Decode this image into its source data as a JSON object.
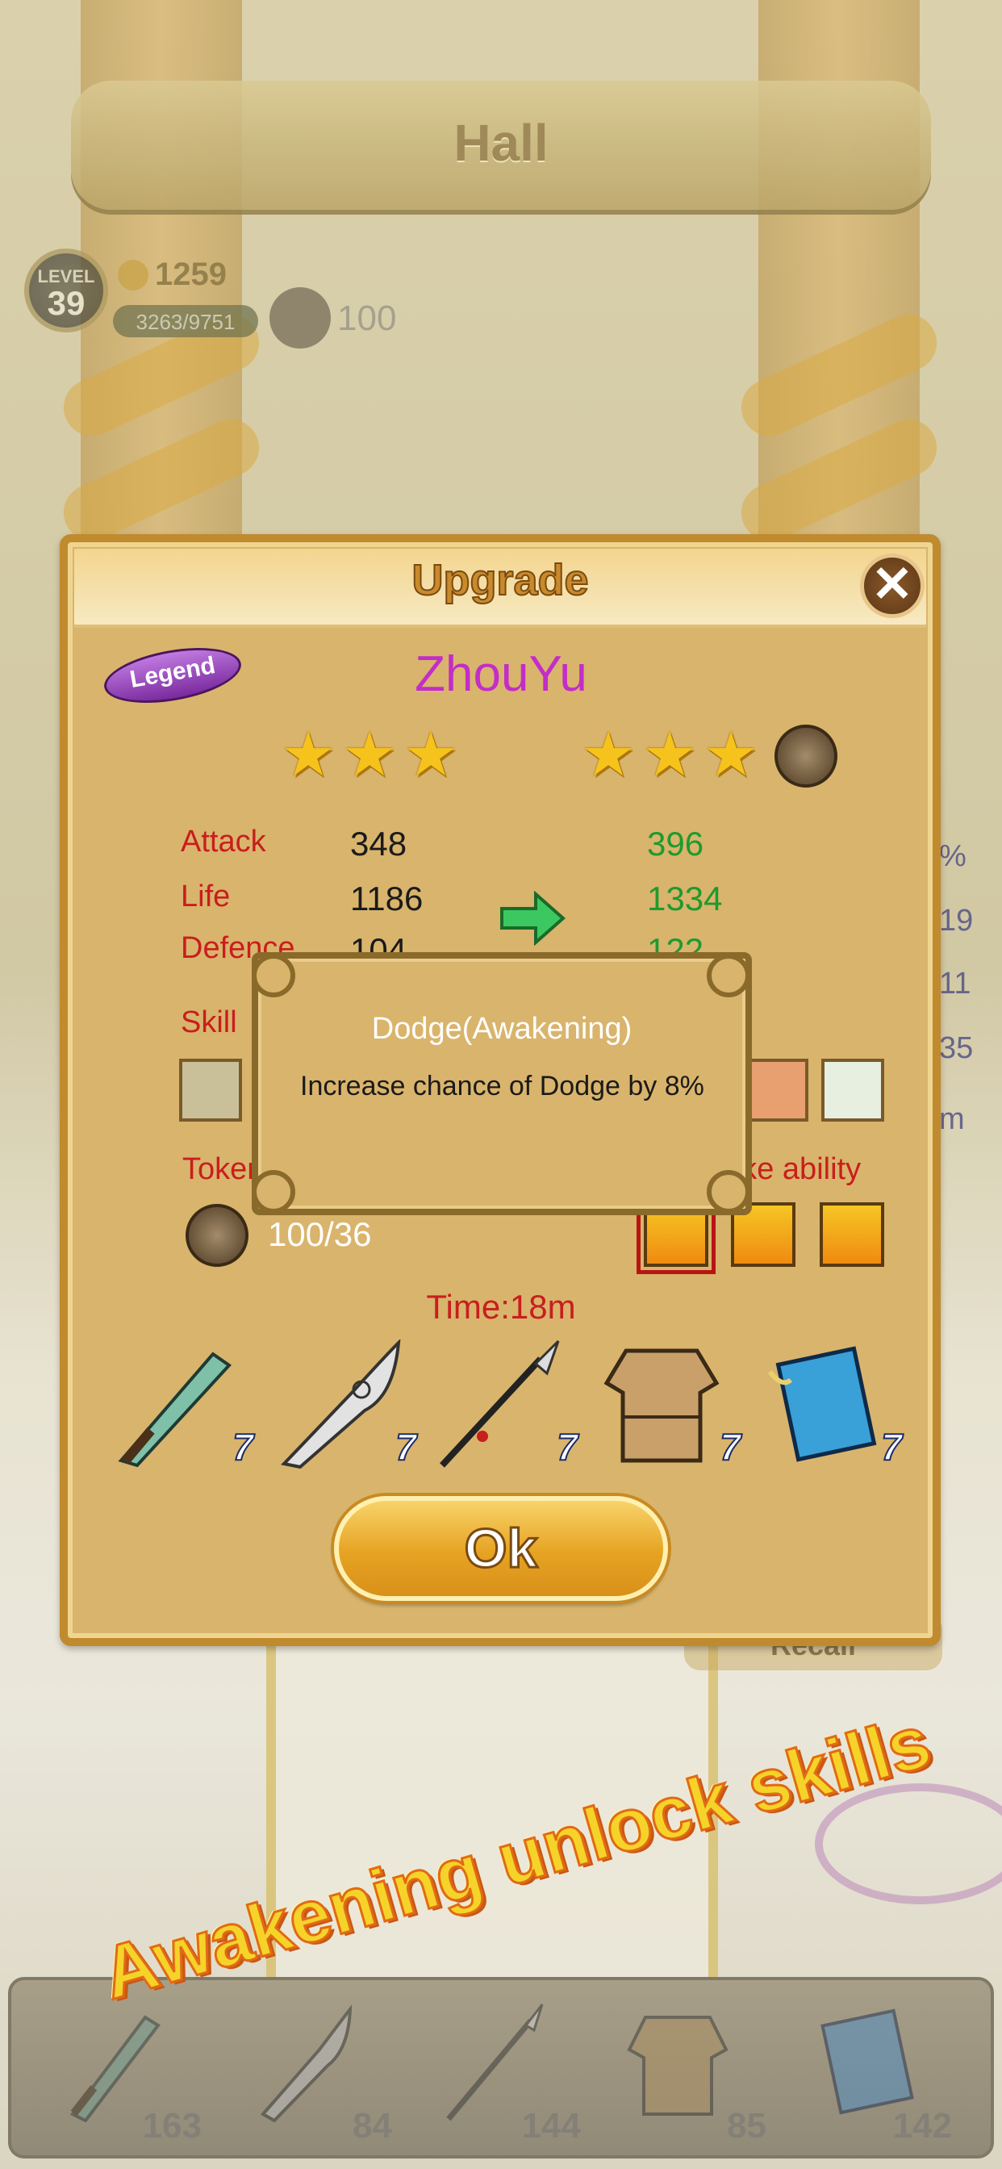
{
  "hall": {
    "title": "Hall"
  },
  "player": {
    "level_label": "LEVEL",
    "level": "39",
    "gold": "1259",
    "exp": "3263/9751",
    "tokens": "100"
  },
  "background": {
    "side_values": [
      "%",
      "19",
      "11",
      "35",
      "m"
    ],
    "recall_label": "Recall"
  },
  "promo": {
    "text": "Awakening unlock skills"
  },
  "inventory": {
    "items": [
      {
        "icon": "sword-icon",
        "count": "163"
      },
      {
        "icon": "blade-icon",
        "count": "84"
      },
      {
        "icon": "spear-icon",
        "count": "144"
      },
      {
        "icon": "armor-icon",
        "count": "85"
      },
      {
        "icon": "book-icon",
        "count": "142"
      }
    ]
  },
  "dialog": {
    "title": "Upgrade",
    "rarity": "Legend",
    "hero_name": "ZhouYu",
    "current_stars": 3,
    "next_stars": 3,
    "stats": [
      {
        "label": "Attack",
        "value": "348",
        "next": "396"
      },
      {
        "label": "Life",
        "value": "1186",
        "next": "1334"
      },
      {
        "label": "Defence",
        "value": "104",
        "next": "122"
      }
    ],
    "skill_label": "Skill",
    "token_label": "Token",
    "ability_label": "Awake ability",
    "token_count": "100/36",
    "time": "Time:18m",
    "equipment": [
      {
        "icon": "sword-icon",
        "level": "7"
      },
      {
        "icon": "blade-icon",
        "level": "7"
      },
      {
        "icon": "spear-icon",
        "level": "7"
      },
      {
        "icon": "armor-icon",
        "level": "7"
      },
      {
        "icon": "book-icon",
        "level": "7"
      }
    ],
    "ok_label": "Ok",
    "colors": {
      "panel": "#d9b46c",
      "frame": "#c08a2e",
      "stat_label": "#c81e1e",
      "stat_next": "#1e9a2e",
      "hero_name": "#c32dc8"
    }
  },
  "tooltip": {
    "title": "Dodge(Awakening)",
    "description": "Increase chance of Dodge by 8%"
  }
}
